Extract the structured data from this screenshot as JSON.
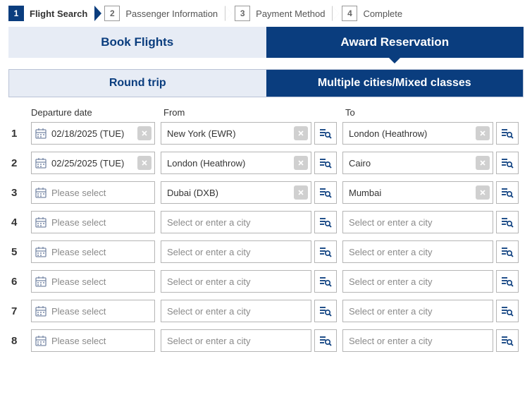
{
  "progress": {
    "steps": [
      {
        "num": "1",
        "label": "Flight Search",
        "active": true
      },
      {
        "num": "2",
        "label": "Passenger Information",
        "active": false
      },
      {
        "num": "3",
        "label": "Payment Method",
        "active": false
      },
      {
        "num": "4",
        "label": "Complete",
        "active": false
      }
    ]
  },
  "main_tabs": {
    "book": "Book Flights",
    "award": "Award Reservation",
    "active": "award"
  },
  "sub_tabs": {
    "round": "Round trip",
    "multi": "Multiple cities/Mixed classes",
    "active": "multi"
  },
  "headers": {
    "date": "Departure date",
    "from": "From",
    "to": "To"
  },
  "placeholders": {
    "date": "Please select",
    "city": "Select or enter a city"
  },
  "rows": [
    {
      "idx": "1",
      "date": "02/18/2025 (TUE)",
      "from": "New York (EWR)",
      "to": "London (Heathrow)"
    },
    {
      "idx": "2",
      "date": "02/25/2025 (TUE)",
      "from": "London (Heathrow)",
      "to": "Cairo"
    },
    {
      "idx": "3",
      "date": "",
      "from": "Dubai (DXB)",
      "to": "Mumbai"
    },
    {
      "idx": "4",
      "date": "",
      "from": "",
      "to": ""
    },
    {
      "idx": "5",
      "date": "",
      "from": "",
      "to": ""
    },
    {
      "idx": "6",
      "date": "",
      "from": "",
      "to": ""
    },
    {
      "idx": "7",
      "date": "",
      "from": "",
      "to": ""
    },
    {
      "idx": "8",
      "date": "",
      "from": "",
      "to": ""
    }
  ]
}
